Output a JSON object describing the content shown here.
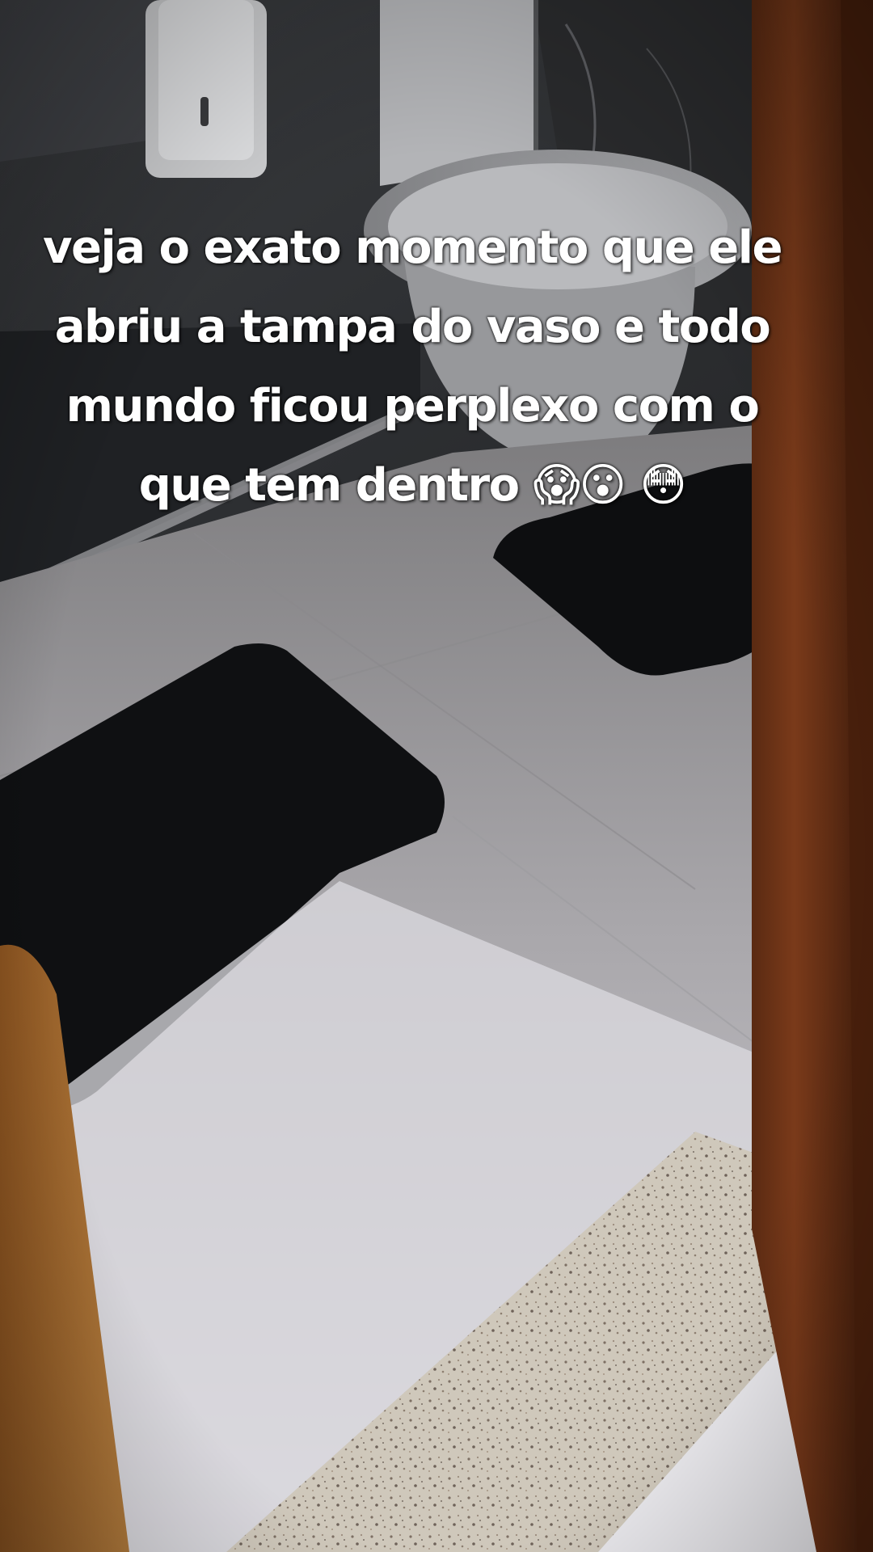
{
  "caption": {
    "text": "veja o exato momento que ele abriu a tampa do vaso e todo mundo ficou perplexo com o que tem dentro 😱😮 😳",
    "color": "#ffffff"
  },
  "scene": {
    "description_tags": [
      "bathroom",
      "toilet",
      "black-bath-mat",
      "tiled-floor",
      "granite-threshold",
      "wooden-door-frame"
    ]
  }
}
